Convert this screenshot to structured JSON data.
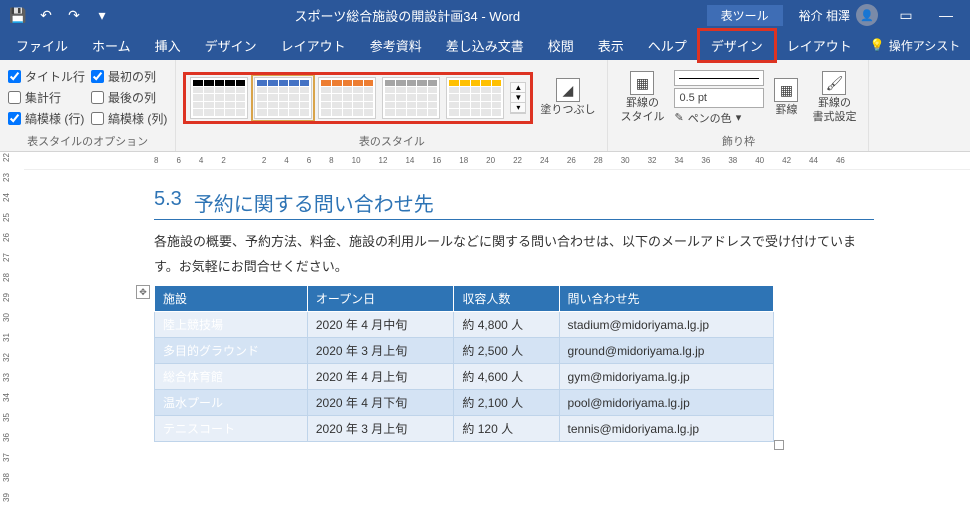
{
  "titlebar": {
    "title": "スポーツ総合施設の開設計画34 - Word",
    "tool_context": "表ツール",
    "user": "裕介 相澤"
  },
  "tabs": [
    "ファイル",
    "ホーム",
    "挿入",
    "デザイン",
    "レイアウト",
    "参考資料",
    "差し込み文書",
    "校閲",
    "表示",
    "ヘルプ",
    "デザイン",
    "レイアウト"
  ],
  "assist": "操作アシスト",
  "style_options": {
    "label": "表スタイルのオプション",
    "left": [
      {
        "label": "タイトル行",
        "checked": true
      },
      {
        "label": "集計行",
        "checked": false
      },
      {
        "label": "縞模様 (行)",
        "checked": true
      }
    ],
    "right": [
      {
        "label": "最初の列",
        "checked": true
      },
      {
        "label": "最後の列",
        "checked": false
      },
      {
        "label": "縞模様 (列)",
        "checked": false
      }
    ]
  },
  "table_styles": {
    "label": "表のスタイル",
    "colors": [
      "#000000",
      "#4472c4",
      "#ed7d31",
      "#a5a5a5",
      "#ffc000"
    ],
    "fill_label": "塗りつぶし"
  },
  "borders": {
    "label": "飾り枠",
    "border_style_label": "罫線の\nスタイル",
    "pen_weight": "0.5 pt",
    "pen_color_label": "ペンの色",
    "borders_btn": "罫線",
    "painter_btn": "罫線の\n書式設定"
  },
  "ruler_h": [
    8,
    6,
    4,
    2,
    "",
    2,
    4,
    6,
    8,
    10,
    12,
    14,
    16,
    18,
    20,
    22,
    24,
    26,
    28,
    30,
    32,
    34,
    36,
    38,
    40,
    42,
    44,
    46
  ],
  "ruler_v": [
    22,
    23,
    24,
    25,
    26,
    27,
    28,
    29,
    30,
    31,
    32,
    33,
    34,
    35,
    36,
    37,
    38,
    39
  ],
  "document": {
    "section_num": "5.3",
    "section_title": "予約に関する問い合わせ先",
    "body": "各施設の概要、予約方法、料金、施設の利用ルールなどに関する問い合わせは、以下のメールアドレスで受け付けています。お気軽にお問合せください。",
    "table": {
      "headers": [
        "施設",
        "オープン日",
        "収容人数",
        "問い合わせ先"
      ],
      "rows": [
        [
          "陸上競技場",
          "2020 年 4 月中旬",
          "約 4,800 人",
          "stadium@midoriyama.lg.jp"
        ],
        [
          "多目的グラウンド",
          "2020 年 3 月上旬",
          "約 2,500 人",
          "ground@midoriyama.lg.jp"
        ],
        [
          "総合体育館",
          "2020 年 4 月上旬",
          "約 4,600 人",
          "gym@midoriyama.lg.jp"
        ],
        [
          "温水プール",
          "2020 年 4 月下旬",
          "約 2,100 人",
          "pool@midoriyama.lg.jp"
        ],
        [
          "テニスコート",
          "2020 年 3 月上旬",
          "約 120 人",
          "tennis@midoriyama.lg.jp"
        ]
      ]
    }
  }
}
